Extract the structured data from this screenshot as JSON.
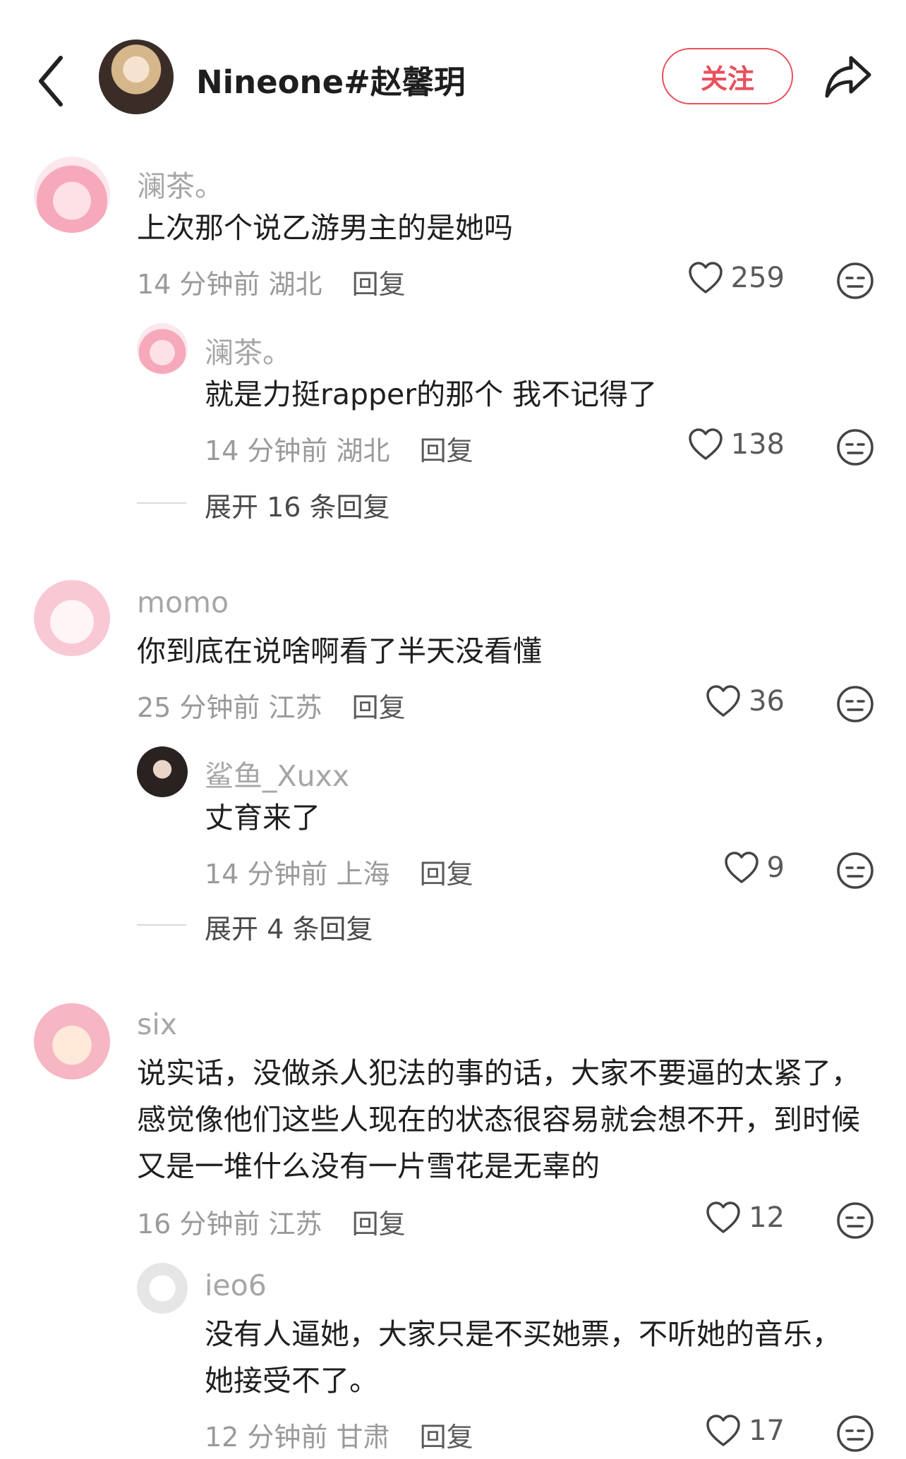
{
  "header": {
    "title": "Nineone#赵馨玥",
    "follow_label": "关注"
  },
  "comments": [
    {
      "user": "澜茶。",
      "text_lines": [
        "上次那个说乙游男主的是她吗"
      ],
      "time": "14 分钟前",
      "location": "湖北",
      "reply_label": "回复",
      "likes": "259",
      "reply": {
        "user": "澜茶。",
        "text_lines": [
          "就是力挺rapper的那个 我不记得了"
        ],
        "time": "14 分钟前",
        "location": "湖北",
        "reply_label": "回复",
        "likes": "138"
      },
      "expand": "展开 16 条回复"
    },
    {
      "user": "momo",
      "text_lines": [
        "你到底在说啥啊看了半天没看懂"
      ],
      "time": "25 分钟前",
      "location": "江苏",
      "reply_label": "回复",
      "likes": "36",
      "reply": {
        "user": "鲨鱼_Xuxx",
        "text_lines": [
          "丈育来了"
        ],
        "time": "14 分钟前",
        "location": "上海",
        "reply_label": "回复",
        "likes": "9"
      },
      "expand": "展开 4 条回复"
    },
    {
      "user": "six",
      "text_lines": [
        "说实话，没做杀人犯法的事的话，大家不要逼的太紧了，",
        "感觉像他们这些人现在的状态很容易就会想不开，到时候",
        "又是一堆什么没有一片雪花是无辜的"
      ],
      "time": "16 分钟前",
      "location": "江苏",
      "reply_label": "回复",
      "likes": "12",
      "reply": {
        "user": "ieo6",
        "text_lines": [
          "没有人逼她，大家只是不买她票，不听她的音乐，",
          "她接受不了。"
        ],
        "time": "12 分钟前",
        "location": "甘肃",
        "reply_label": "回复",
        "likes": "17"
      }
    }
  ]
}
